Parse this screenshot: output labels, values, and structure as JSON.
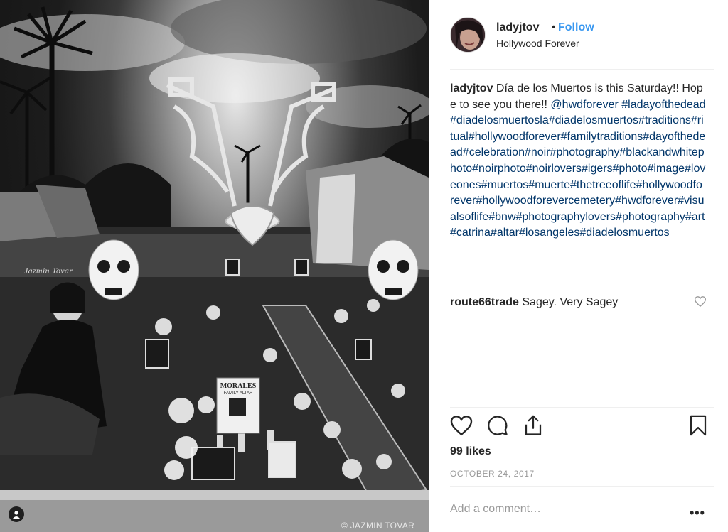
{
  "photo": {
    "watermark_left": "Jazmin Tovar",
    "copyright": "© JAZMIN TOVAR",
    "sign_text": "MORALES",
    "sign_subtext": "FAMILY ALTAR",
    "tag_icon": "user-tag-icon"
  },
  "post": {
    "username": "ladyjtov",
    "separator": "•",
    "follow_label": "Follow",
    "location": "Hollywood Forever",
    "caption_user": "ladyjtov",
    "caption_text": " Día de los Muertos is this Saturday!! Hope to see you there!! ",
    "caption_mention": "@hwdforever",
    "caption_tags": "#ladayofthedead#diadelosmuertosla#diadelosmuertos#traditions#ritual#hollywoodforever#familytraditions#dayofthedead#celebration#noir#photography#blackandwhitephoto#noirphoto#noirlovers#igers#photo#image#loveones#muertos#muerte#thetreeoflife#hollywoodforever#hollywoodforevercemetery#hwdforever#visualsoflife#bnw#photographylovers#photography#art#catrina#altar#losangeles#diadelosmuertos"
  },
  "comments": [
    {
      "user": "route66trade",
      "text": " Sagey. Very Sagey"
    }
  ],
  "actions": {
    "like_icon": "heart-icon",
    "comment_icon": "comment-icon",
    "share_icon": "share-icon",
    "save_icon": "bookmark-icon"
  },
  "likes_text": "99 likes",
  "date_text": "OCTOBER 24, 2017",
  "add_comment_placeholder": "Add a comment…",
  "more_label": "•••",
  "colors": {
    "link": "#003569",
    "follow": "#3897f0",
    "muted": "#999999",
    "text": "#262626"
  }
}
